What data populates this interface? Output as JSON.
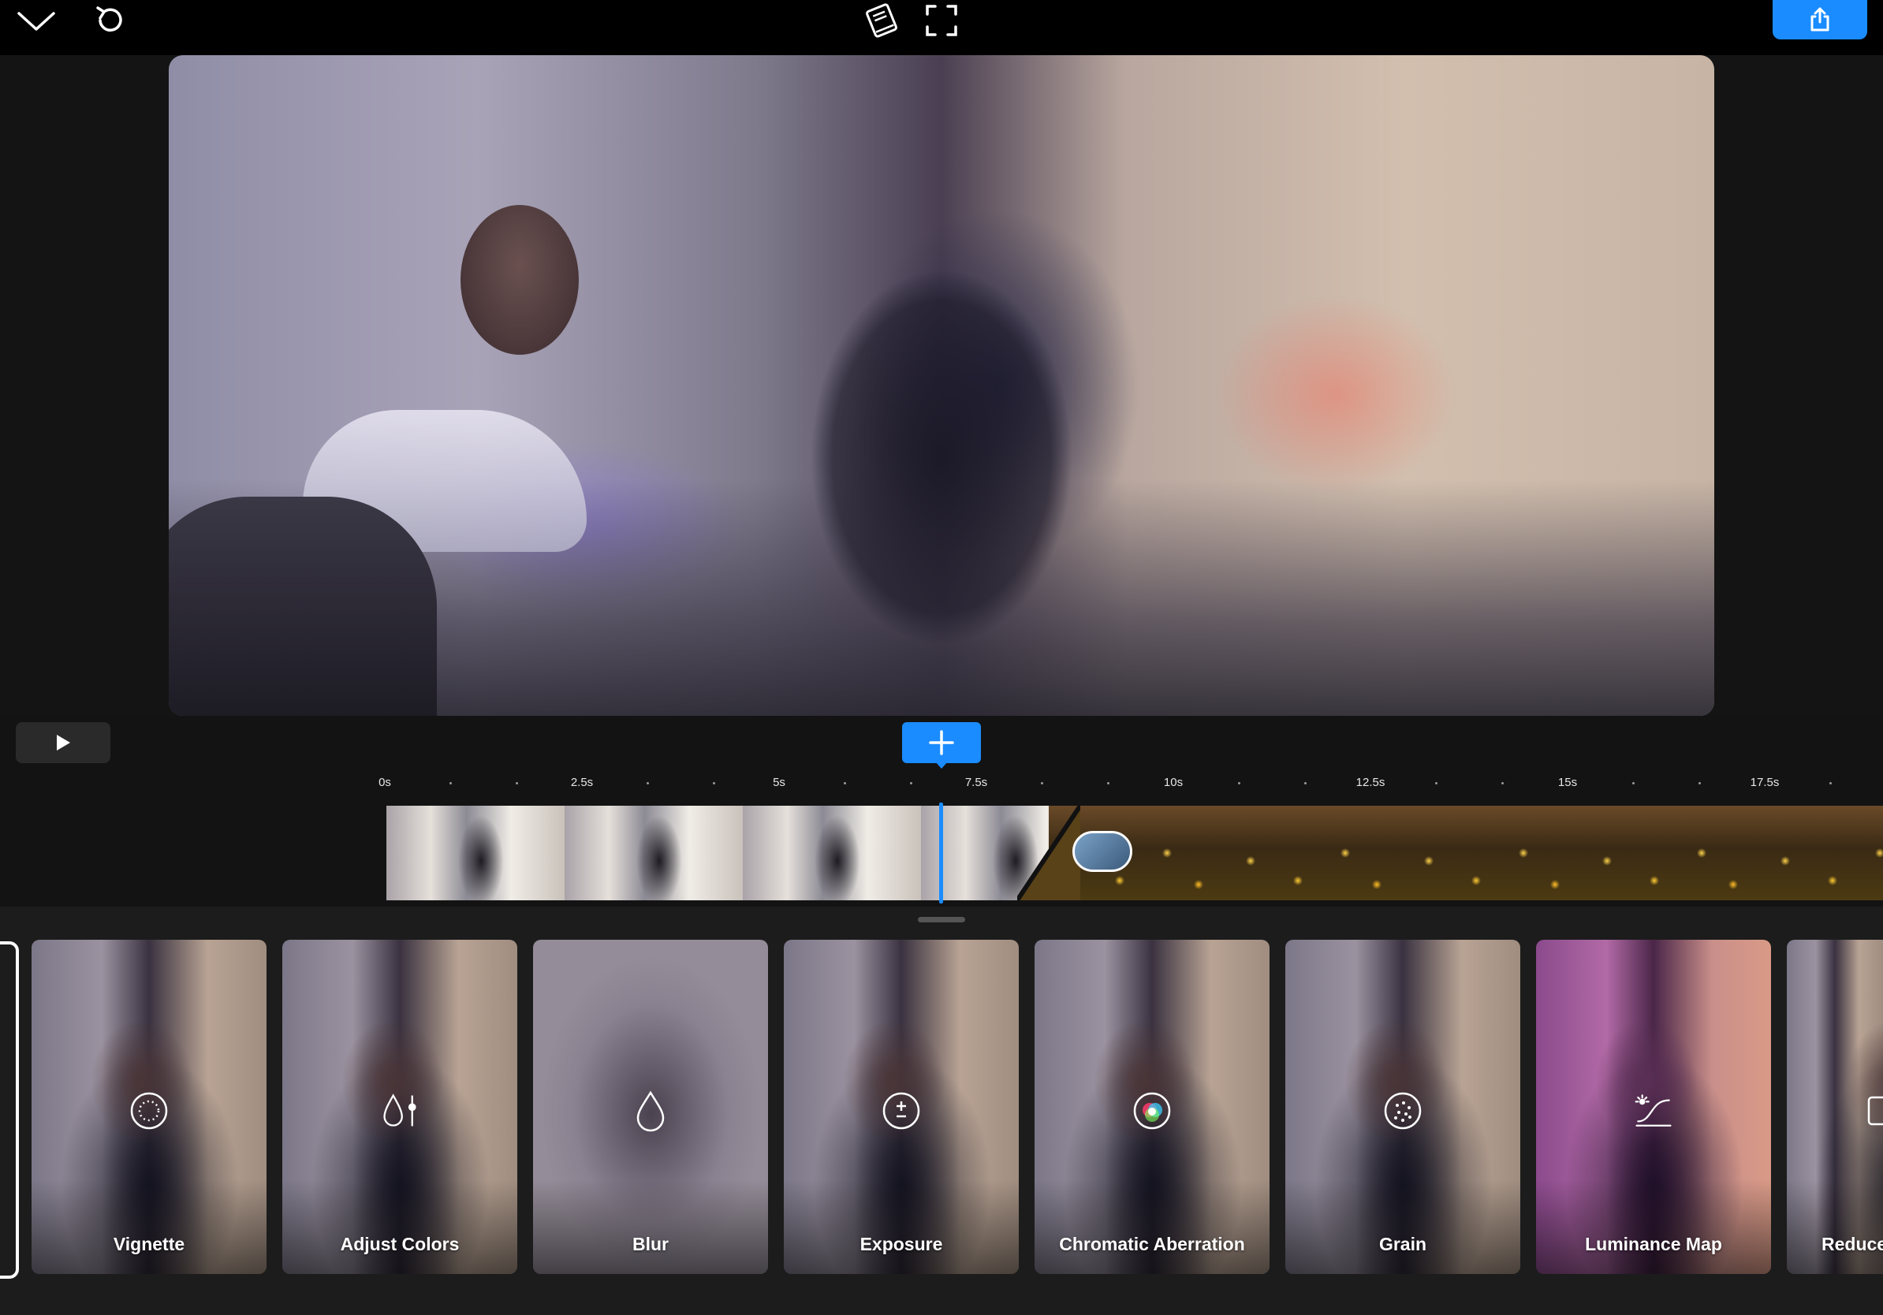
{
  "toolbar": {
    "collapse_icon": "chevron-down-icon",
    "undo_icon": "undo-icon",
    "guide_icon": "book-icon",
    "fullscreen_icon": "fullscreen-icon",
    "export_icon": "share-icon",
    "accent": "#1a8cff"
  },
  "playback": {
    "play_icon": "play-icon",
    "add_icon": "plus-icon"
  },
  "ruler": {
    "labels": [
      "0s",
      "2.5s",
      "5s",
      "7.5s",
      "10s",
      "12.5s",
      "15s",
      "17.5s"
    ]
  },
  "timeline": {
    "clip1_frames": 4,
    "clip2_frames": 5
  },
  "effects": [
    {
      "label": "Vignette",
      "icon": "vignette-icon"
    },
    {
      "label": "Adjust Colors",
      "icon": "adjust-colors-icon"
    },
    {
      "label": "Blur",
      "icon": "droplet-icon"
    },
    {
      "label": "Exposure",
      "icon": "exposure-icon"
    },
    {
      "label": "Chromatic Aberration",
      "icon": "color-wheel-icon"
    },
    {
      "label": "Grain",
      "icon": "grain-icon"
    },
    {
      "label": "Luminance Map",
      "icon": "luminance-curve-icon"
    },
    {
      "label": "Reduce",
      "icon": "reduce-icon"
    }
  ]
}
